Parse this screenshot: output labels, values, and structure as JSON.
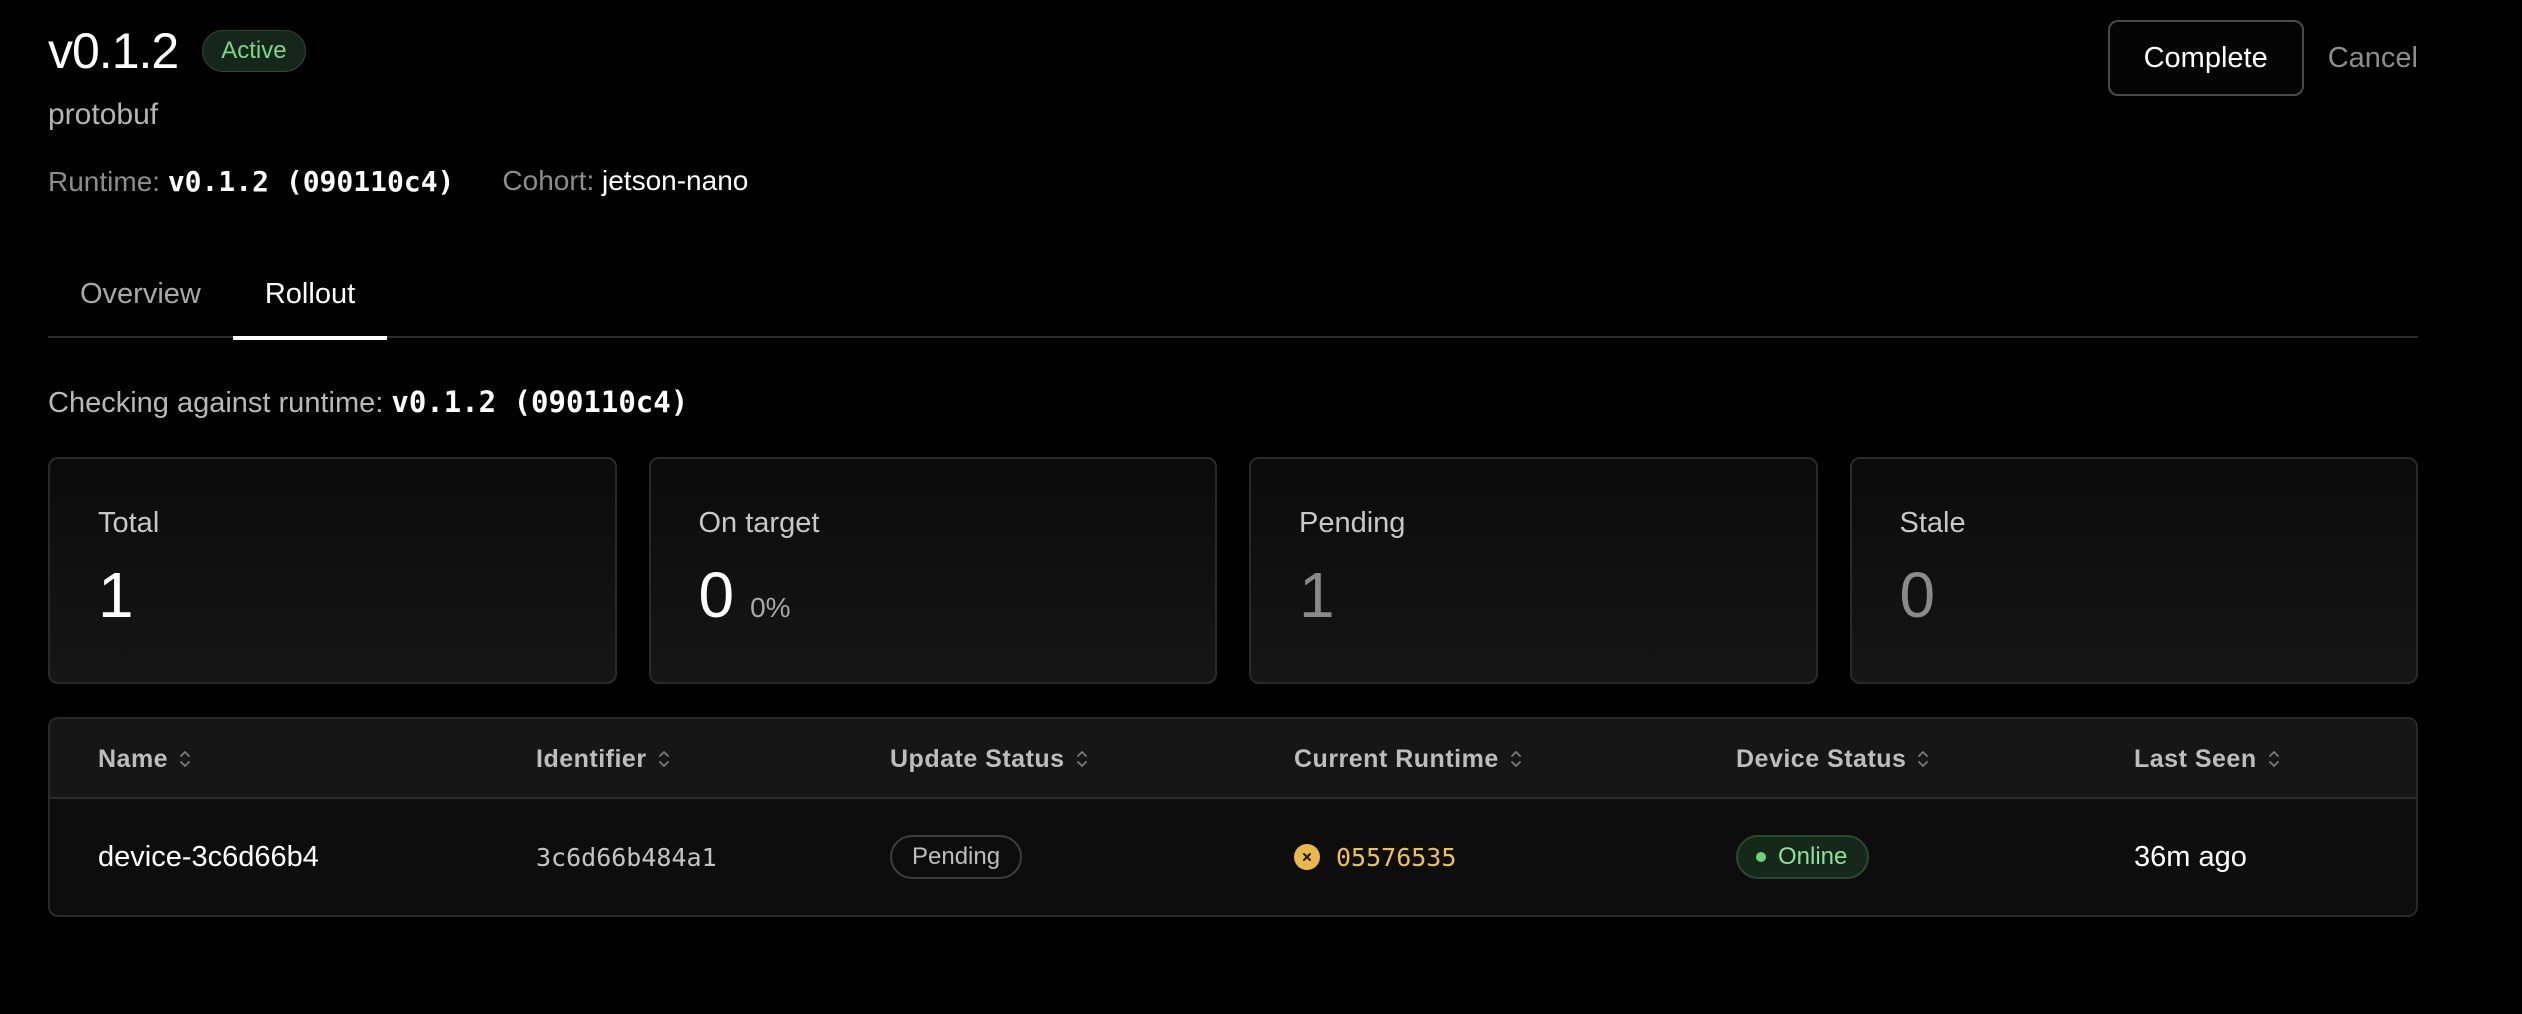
{
  "header": {
    "title": "v0.1.2",
    "status_badge": "Active",
    "subtitle": "protobuf",
    "runtime_label": "Runtime:",
    "runtime_value": "v0.1.2 (090110c4)",
    "cohort_label": "Cohort:",
    "cohort_value": "jetson-nano"
  },
  "actions": {
    "complete_label": "Complete",
    "cancel_label": "Cancel"
  },
  "tabs": [
    {
      "label": "Overview",
      "active": false
    },
    {
      "label": "Rollout",
      "active": true
    }
  ],
  "checking": {
    "label": "Checking against runtime:",
    "value": "v0.1.2 (090110c4)"
  },
  "stats": [
    {
      "label": "Total",
      "value": "1"
    },
    {
      "label": "On target",
      "value": "0",
      "sub": "0%"
    },
    {
      "label": "Pending",
      "value": "1"
    },
    {
      "label": "Stale",
      "value": "0"
    }
  ],
  "table": {
    "columns": [
      "Name",
      "Identifier",
      "Update Status",
      "Current Runtime",
      "Device Status",
      "Last Seen"
    ],
    "rows": [
      {
        "name": "device-3c6d66b4",
        "identifier": "3c6d66b484a1",
        "update_status": "Pending",
        "current_runtime": "05576535",
        "device_status": "Online",
        "last_seen": "36m ago"
      }
    ]
  },
  "colors": {
    "background": "#000000",
    "accent_green": "#7fd48a",
    "runtime_warning": "#f0c14b"
  }
}
